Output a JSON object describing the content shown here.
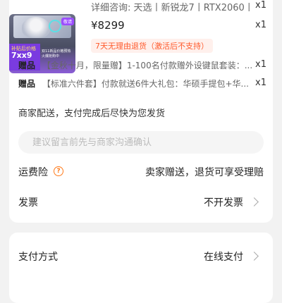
{
  "product": {
    "spec": "详细咨询: 天选丨新锐龙7丨RTX2060丨",
    "price": "¥8299",
    "quantity": "x1",
    "return_policy": "7天无理由退货（激活后不支持）",
    "thumbnail": {
      "tag": "敬请",
      "promo_top": "补贴后价格",
      "promo_price": "7xx9",
      "promo_note": "双11新品价格预热火爆抢购中"
    }
  },
  "gifts": [
    {
      "label": "赠品",
      "text": "【金秋十月，限量赠】1-100名付款赠外设键鼠套装：...",
      "quantity": "x1"
    },
    {
      "label": "赠品",
      "text": "【标准六件套】付款就送6件大礼包：华硕手提包+华...",
      "quantity": "x1"
    }
  ],
  "delivery_note": "商家配送，支付完成后尽快为您发货",
  "message": {
    "placeholder": "建议留言前先与商家沟通确认",
    "value": ""
  },
  "shipping_insurance": {
    "label": "运费险",
    "value": "卖家赠送，退货可享受理赔"
  },
  "invoice": {
    "label": "发票",
    "value": "不开发票"
  },
  "payment": {
    "label": "支付方式",
    "value": "在线支付"
  }
}
